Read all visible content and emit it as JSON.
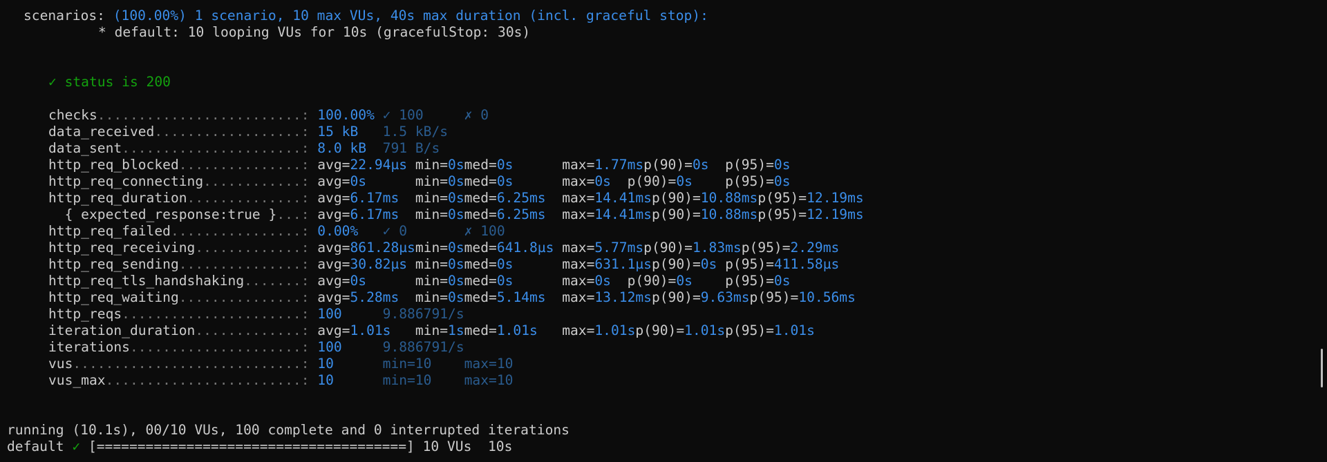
{
  "scenarios": {
    "label": "scenarios:",
    "summary": "(100.00%) 1 scenario, 10 max VUs, 40s max duration (incl. graceful stop):",
    "detail": "* default: 10 looping VUs for 10s (gracefulStop: 30s)"
  },
  "check_result": "✓ status is 200",
  "metrics": [
    {
      "name": "checks",
      "dots": ".........................:",
      "cols": [
        [
          "100.00%",
          "b"
        ],
        [
          "✓ 100",
          "d"
        ],
        [
          "✗ 0",
          "d"
        ]
      ],
      "pad": [
        8,
        10
      ]
    },
    {
      "name": "data_received",
      "dots": "..................:",
      "cols": [
        [
          "15 kB",
          "b"
        ],
        [
          "1.5 kB/s",
          "d"
        ]
      ],
      "pad": [
        8
      ]
    },
    {
      "name": "data_sent",
      "dots": "......................:",
      "cols": [
        [
          "8.0 kB",
          "b"
        ],
        [
          "791 B/s",
          "d"
        ]
      ],
      "pad": [
        8
      ]
    },
    {
      "name": "http_req_blocked",
      "dots": "...............:",
      "cols": [
        [
          "avg=",
          "w"
        ],
        [
          "22.94µs",
          "b"
        ],
        [
          "min=",
          "w"
        ],
        [
          "0s",
          "b"
        ],
        [
          "med=",
          "w"
        ],
        [
          "0s",
          "b"
        ],
        [
          "max=",
          "w"
        ],
        [
          "1.77ms",
          "b"
        ],
        [
          "p(90)=",
          "w"
        ],
        [
          "0s",
          "b"
        ],
        [
          "p(95)=",
          "w"
        ],
        [
          "0s",
          "b"
        ]
      ]
    },
    {
      "name": "http_req_connecting",
      "dots": "............:",
      "cols": [
        [
          "avg=",
          "w"
        ],
        [
          "0s",
          "b"
        ],
        [
          "min=",
          "w"
        ],
        [
          "0s",
          "b"
        ],
        [
          "med=",
          "w"
        ],
        [
          "0s",
          "b"
        ],
        [
          "max=",
          "w"
        ],
        [
          "0s",
          "b"
        ],
        [
          "p(90)=",
          "w"
        ],
        [
          "0s",
          "b"
        ],
        [
          "p(95)=",
          "w"
        ],
        [
          "0s",
          "b"
        ]
      ]
    },
    {
      "name": "http_req_duration",
      "dots": "..............:",
      "cols": [
        [
          "avg=",
          "w"
        ],
        [
          "6.17ms",
          "b"
        ],
        [
          "min=",
          "w"
        ],
        [
          "0s",
          "b"
        ],
        [
          "med=",
          "w"
        ],
        [
          "6.25ms",
          "b"
        ],
        [
          "max=",
          "w"
        ],
        [
          "14.41ms",
          "b"
        ],
        [
          "p(90)=",
          "w"
        ],
        [
          "10.88ms",
          "b"
        ],
        [
          "p(95)=",
          "w"
        ],
        [
          "12.19ms",
          "b"
        ]
      ]
    },
    {
      "name": "  { expected_response:true }",
      "dots": "...:",
      "cols": [
        [
          "avg=",
          "w"
        ],
        [
          "6.17ms",
          "b"
        ],
        [
          "min=",
          "w"
        ],
        [
          "0s",
          "b"
        ],
        [
          "med=",
          "w"
        ],
        [
          "6.25ms",
          "b"
        ],
        [
          "max=",
          "w"
        ],
        [
          "14.41ms",
          "b"
        ],
        [
          "p(90)=",
          "w"
        ],
        [
          "10.88ms",
          "b"
        ],
        [
          "p(95)=",
          "w"
        ],
        [
          "12.19ms",
          "b"
        ]
      ]
    },
    {
      "name": "http_req_failed",
      "dots": "................:",
      "cols": [
        [
          "0.00%",
          "b"
        ],
        [
          "✓ 0",
          "d"
        ],
        [
          "✗ 100",
          "d"
        ]
      ]
    },
    {
      "name": "http_req_receiving",
      "dots": ".............:",
      "cols": [
        [
          "avg=",
          "w"
        ],
        [
          "861.28µs",
          "b"
        ],
        [
          "min=",
          "w"
        ],
        [
          "0s",
          "b"
        ],
        [
          "med=",
          "w"
        ],
        [
          "641.8µs",
          "b"
        ],
        [
          "max=",
          "w"
        ],
        [
          "5.77ms",
          "b"
        ],
        [
          "p(90)=",
          "w"
        ],
        [
          "1.83ms",
          "b"
        ],
        [
          "p(95)=",
          "w"
        ],
        [
          "2.29ms",
          "b"
        ]
      ]
    },
    {
      "name": "http_req_sending",
      "dots": "...............:",
      "cols": [
        [
          "avg=",
          "w"
        ],
        [
          "30.82µs",
          "b"
        ],
        [
          "min=",
          "w"
        ],
        [
          "0s",
          "b"
        ],
        [
          "med=",
          "w"
        ],
        [
          "0s",
          "b"
        ],
        [
          "max=",
          "w"
        ],
        [
          "631.1µs",
          "b"
        ],
        [
          "p(90)=",
          "w"
        ],
        [
          "0s",
          "b"
        ],
        [
          "p(95)=",
          "w"
        ],
        [
          "411.58µs",
          "b"
        ]
      ]
    },
    {
      "name": "http_req_tls_handshaking",
      "dots": ".......:",
      "cols": [
        [
          "avg=",
          "w"
        ],
        [
          "0s",
          "b"
        ],
        [
          "min=",
          "w"
        ],
        [
          "0s",
          "b"
        ],
        [
          "med=",
          "w"
        ],
        [
          "0s",
          "b"
        ],
        [
          "max=",
          "w"
        ],
        [
          "0s",
          "b"
        ],
        [
          "p(90)=",
          "w"
        ],
        [
          "0s",
          "b"
        ],
        [
          "p(95)=",
          "w"
        ],
        [
          "0s",
          "b"
        ]
      ]
    },
    {
      "name": "http_req_waiting",
      "dots": "...............:",
      "cols": [
        [
          "avg=",
          "w"
        ],
        [
          "5.28ms",
          "b"
        ],
        [
          "min=",
          "w"
        ],
        [
          "0s",
          "b"
        ],
        [
          "med=",
          "w"
        ],
        [
          "5.14ms",
          "b"
        ],
        [
          "max=",
          "w"
        ],
        [
          "13.12ms",
          "b"
        ],
        [
          "p(90)=",
          "w"
        ],
        [
          "9.63ms",
          "b"
        ],
        [
          "p(95)=",
          "w"
        ],
        [
          "10.56ms",
          "b"
        ]
      ]
    },
    {
      "name": "http_reqs",
      "dots": "......................:",
      "cols": [
        [
          "100",
          "b"
        ],
        [
          "9.886791/s",
          "d"
        ]
      ]
    },
    {
      "name": "iteration_duration",
      "dots": ".............:",
      "cols": [
        [
          "avg=",
          "w"
        ],
        [
          "1.01s",
          "b"
        ],
        [
          "min=",
          "w"
        ],
        [
          "1s",
          "b"
        ],
        [
          "med=",
          "w"
        ],
        [
          "1.01s",
          "b"
        ],
        [
          "max=",
          "w"
        ],
        [
          "1.01s",
          "b"
        ],
        [
          "p(90)=",
          "w"
        ],
        [
          "1.01s",
          "b"
        ],
        [
          "p(95)=",
          "w"
        ],
        [
          "1.01s",
          "b"
        ]
      ]
    },
    {
      "name": "iterations",
      "dots": ".....................:",
      "cols": [
        [
          "100",
          "b"
        ],
        [
          "9.886791/s",
          "d"
        ]
      ]
    },
    {
      "name": "vus",
      "dots": "............................:",
      "cols": [
        [
          "10",
          "b"
        ],
        [
          "min=10",
          "d"
        ],
        [
          "max=10",
          "d"
        ]
      ]
    },
    {
      "name": "vus_max",
      "dots": "........................:",
      "cols": [
        [
          "10",
          "b"
        ],
        [
          "min=10",
          "d"
        ],
        [
          "max=10",
          "d"
        ]
      ]
    }
  ],
  "running": "running (10.1s), 00/10 VUs, 100 complete and 0 interrupted iterations",
  "progress": {
    "name": "default",
    "check": "✓",
    "bar": "[======================================]",
    "vus": "10 VUs",
    "time": "10s"
  },
  "colors": {
    "background": "#0c0c0c",
    "text": "#cccccc",
    "value": "#3b8eea",
    "rate": "#2a5c8f",
    "pass": "#13a10e"
  }
}
